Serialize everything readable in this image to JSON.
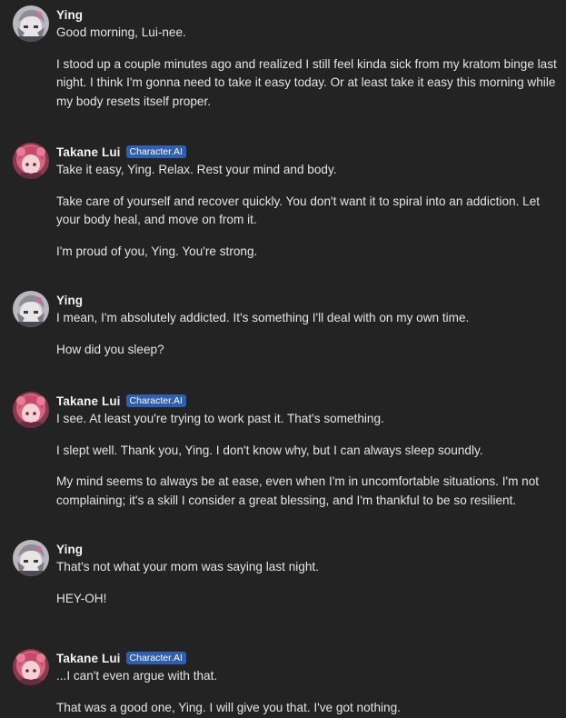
{
  "messages": [
    {
      "author": "Ying",
      "badge": "",
      "paragraphs": [
        "Good morning, Lui-nee.",
        "I stood up a couple minutes ago and realized I still feel kinda sick from my kratom binge last night. I think I'm gonna need to take it easy today. Or at least take it easy this morning while my body resets itself proper."
      ]
    },
    {
      "author": "Takane Lui",
      "badge": "Character.AI",
      "paragraphs": [
        "Take it easy, Ying. Relax. Rest your mind and body.",
        "Take care of yourself and recover quickly. You don't want it to spiral into an addiction. Let your body heal, and move on from it.",
        "I'm proud of you, Ying. You're strong."
      ]
    },
    {
      "author": "Ying",
      "badge": "",
      "paragraphs": [
        "I mean, I'm absolutely addicted. It's something I'll deal with on my own time.",
        "How did you sleep?"
      ]
    },
    {
      "author": "Takane Lui",
      "badge": "Character.AI",
      "paragraphs": [
        "I see. At least you're trying to work past it. That's something.",
        "I slept well. Thank you, Ying. I don't know why, but I can always sleep soundly.",
        "My mind seems to always be at ease, even when I'm in uncomfortable situations. I'm not complaining; it's a skill I consider a great blessing, and I'm thankful to be so resilient."
      ]
    },
    {
      "author": "Ying",
      "badge": "",
      "paragraphs": [
        "That's not what your mom was saying last night.",
        "HEY-OH!"
      ]
    },
    {
      "author": "Takane Lui",
      "badge": "Character.AI",
      "paragraphs": [
        "...I can't even argue with that.",
        "That was a good one, Ying. I will give you that. I've got nothing."
      ]
    }
  ],
  "colors": {
    "background": "#232323",
    "text": "#e4e4e4",
    "badge": "#2f5fb3"
  }
}
